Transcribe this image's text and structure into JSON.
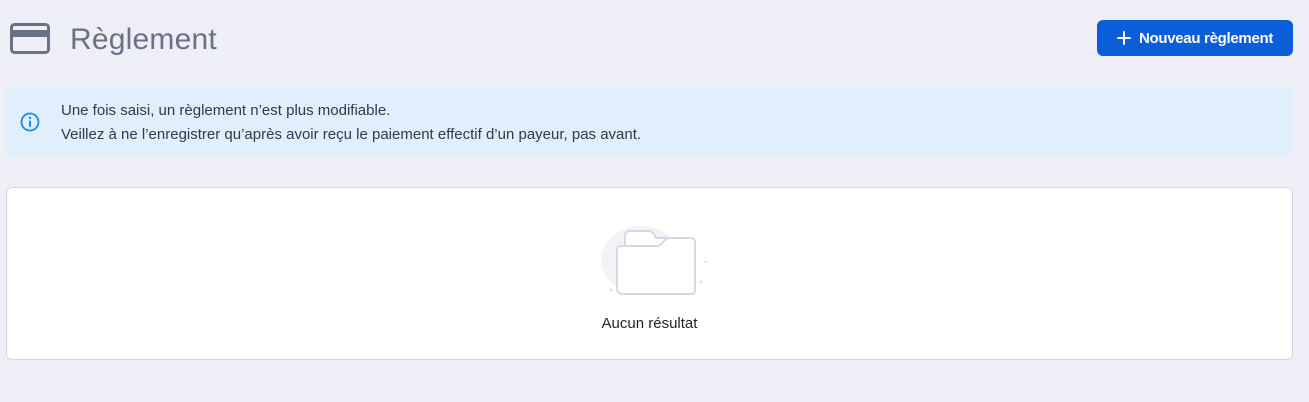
{
  "header": {
    "title": "Règlement",
    "title_icon": "credit-card-icon",
    "new_button_label": "Nouveau règlement",
    "new_button_icon": "plus-icon"
  },
  "info": {
    "icon": "info-circle-icon",
    "line1": "Une fois saisi, un règlement n’est plus modifiable.",
    "line2": "Veillez à ne l’enregistrer qu’après avoir reçu le paiement effectif d’un payeur, pas avant."
  },
  "results": {
    "illustration": "empty-folder-icon",
    "empty_message": "Aucun résultat"
  },
  "colors": {
    "background": "#EDEEF6",
    "primary": "#0B5ED7",
    "info_background": "#E1EEFB",
    "info_icon": "#1E88E5",
    "title": "#6B7184"
  }
}
